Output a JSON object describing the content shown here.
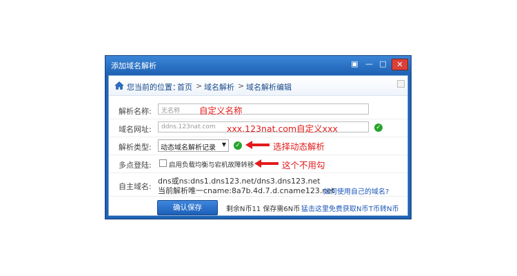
{
  "window": {
    "title": "添加域名解析",
    "controls": {
      "menu": "▣",
      "minimize": "—",
      "maximize": "□",
      "close": "✕"
    }
  },
  "breadcrumb": {
    "prefix": "您当前的位置：",
    "items": [
      "首页",
      "域名解析",
      "域名解析编辑"
    ],
    "separator": ">"
  },
  "form": {
    "name": {
      "label": "解析名称:",
      "placeholder": "无名称",
      "annotation": "自定义名称"
    },
    "url": {
      "label": "域名网址:",
      "placeholder": "ddns.123nat.com",
      "annotation": "xxx.123nat.com自定义xxx"
    },
    "type": {
      "label": "解析类型:",
      "value": "动态域名解析记录",
      "annotation": "选择动态解析"
    },
    "multipoint": {
      "label": "多点登陆:",
      "checkbox_label": "启用负载均衡与宕机故障转移",
      "checked": false,
      "annotation": "这个不用勾"
    },
    "own_domain": {
      "label": "自主域名:",
      "line1": "dns或ns:dns1.dns123.net/dns3.dns123.net",
      "line2": "当前解析唯一cname:8a7b.4d.7.d.cname123.net",
      "help_link": "如何使用自己的域名?"
    }
  },
  "footer": {
    "confirm_label": "确认保存",
    "status": "剩余N币11 保存需6N币",
    "free_link": "猛击这里免费获取N币",
    "transfer_link": "T币转N币"
  },
  "colors": {
    "accent": "#1f63b5",
    "annotation": "#e31b1b",
    "ok": "#27a32c"
  }
}
